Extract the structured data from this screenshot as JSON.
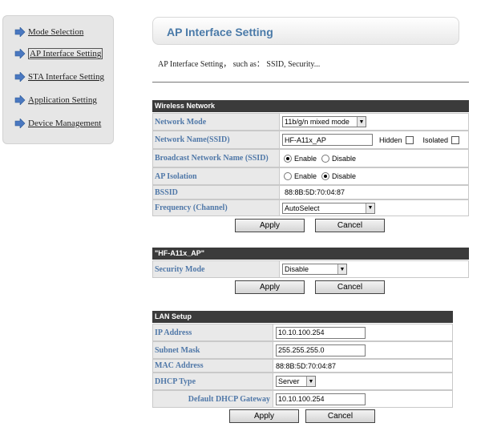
{
  "nav": {
    "items": [
      {
        "label": "Mode Selection"
      },
      {
        "label": "AP Interface Setting"
      },
      {
        "label": "STA Interface Setting"
      },
      {
        "label": "Application Setting"
      },
      {
        "label": "Device Management"
      }
    ],
    "active_index": 1
  },
  "header": {
    "title": "AP Interface Setting",
    "description": "AP Interface Setting， such as： SSID, Security..."
  },
  "wireless": {
    "title": "Wireless Network",
    "mode_label": "Network Mode",
    "mode_value": "11b/g/n mixed mode",
    "ssid_label": "Network Name(SSID)",
    "ssid_value": "HF-A11x_AP",
    "hidden_label": "Hidden",
    "isolated_label": "Isolated",
    "broadcast_label": "Broadcast Network Name (SSID)",
    "broadcast_enable": "Enable",
    "broadcast_disable": "Disable",
    "broadcast_selected": "Enable",
    "isolation_label": "AP Isolation",
    "isolation_enable": "Enable",
    "isolation_disable": "Disable",
    "isolation_selected": "Disable",
    "bssid_label": "BSSID",
    "bssid_value": "88:8B:5D:70:04:87",
    "freq_label": "Frequency (Channel)",
    "freq_value": "AutoSelect",
    "apply": "Apply",
    "cancel": "Cancel"
  },
  "security": {
    "title": "\"HF-A11x_AP\"",
    "mode_label": "Security Mode",
    "mode_value": "Disable",
    "apply": "Apply",
    "cancel": "Cancel"
  },
  "lan": {
    "title": "LAN Setup",
    "ip_label": "IP Address",
    "ip_value": "10.10.100.254",
    "mask_label": "Subnet Mask",
    "mask_value": "255.255.255.0",
    "mac_label": "MAC Address",
    "mac_value": "88:8B:5D:70:04:87",
    "dhcp_label": "DHCP Type",
    "dhcp_value": "Server",
    "gateway_label": "Default DHCP Gateway",
    "gateway_value": "10.10.100.254",
    "apply": "Apply",
    "cancel": "Cancel"
  },
  "colors": {
    "label_blue": "#5078a8",
    "title_blue": "#4a7aa8",
    "section_header": "#3b3b3b",
    "label_bg": "#e9e9e9"
  }
}
